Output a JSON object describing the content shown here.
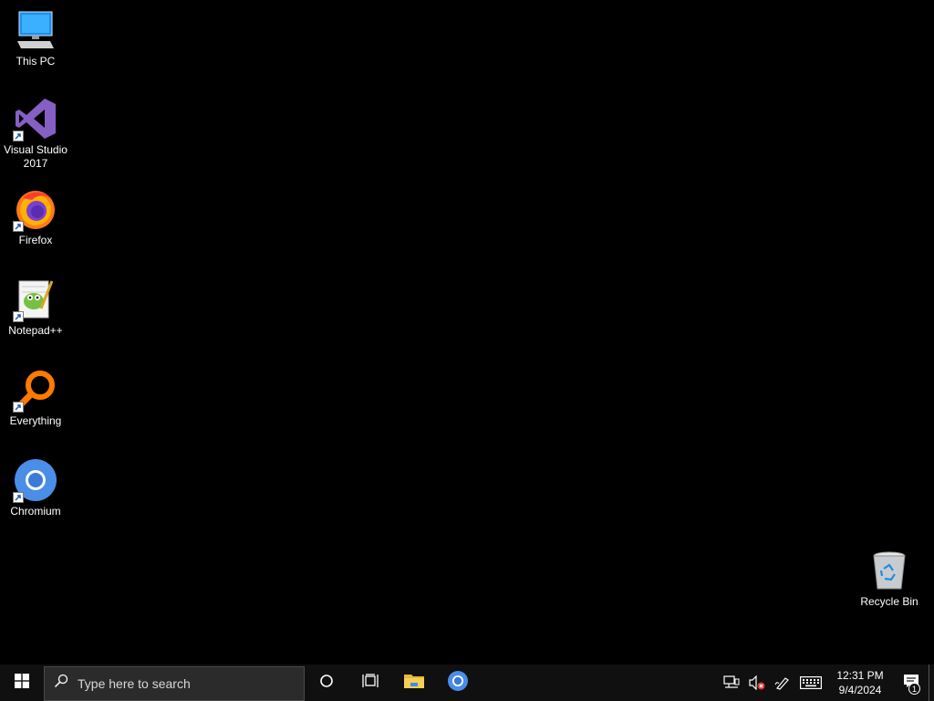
{
  "desktop": {
    "icons": [
      {
        "label": "This PC",
        "icon": "this-pc-icon"
      },
      {
        "label": "Visual Studio\n2017",
        "icon": "visual-studio-icon"
      },
      {
        "label": "Firefox",
        "icon": "firefox-icon"
      },
      {
        "label": "Notepad++",
        "icon": "notepad-plus-plus-icon"
      },
      {
        "label": "Everything",
        "icon": "everything-search-icon"
      },
      {
        "label": "Chromium",
        "icon": "chromium-icon"
      },
      {
        "label": "Recycle Bin",
        "icon": "recycle-bin-icon"
      }
    ]
  },
  "taskbar": {
    "start_icon": "windows-logo-icon",
    "search": {
      "placeholder": "Type here to search",
      "icon": "search-icon"
    },
    "cortana_icon": "cortana-icon",
    "task_view_icon": "task-view-icon",
    "pinned": [
      {
        "name": "File Explorer",
        "icon": "file-explorer-icon"
      },
      {
        "name": "Chromium",
        "icon": "chromium-icon"
      }
    ],
    "tray": {
      "icons": [
        "network-icon",
        "volume-muted-icon",
        "pen-icon",
        "keyboard-icon"
      ],
      "time": "12:31 PM",
      "date": "9/4/2024",
      "notification_count": "1"
    }
  },
  "colors": {
    "desktop_bg": "#000000",
    "taskbar_bg": "#101010",
    "accent": "#76b9ed"
  }
}
